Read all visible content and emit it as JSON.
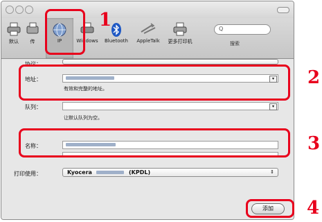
{
  "toolbar": {
    "items": [
      {
        "label": "默认",
        "icon": "printer-icon"
      },
      {
        "label": "传",
        "icon": "fax-icon"
      },
      {
        "label": "IP",
        "icon": "globe-icon"
      },
      {
        "label": "Windows",
        "icon": "windows-printer-icon"
      },
      {
        "label": "Bluetooth",
        "icon": "bluetooth-icon"
      },
      {
        "label": "AppleTalk",
        "icon": "appletalk-icon"
      },
      {
        "label": "更多打印机",
        "icon": "printer-icon"
      }
    ],
    "search_placeholder": "Q",
    "search_label": "搜索"
  },
  "form": {
    "protocol_label": "协议：",
    "address_label": "地址：",
    "address_hint": "有效和完整的地址。",
    "queue_label": "队列：",
    "queue_hint": "让默认队列为空。",
    "name_label": "名称：",
    "print_using_label": "打印使用：",
    "print_using_prefix": "Kyocera",
    "print_using_suffix": "(KPDL)"
  },
  "add_button_label": "添加",
  "callouts": [
    "1",
    "2",
    "3",
    "4"
  ],
  "colors": {
    "highlight": "#e8001c",
    "window_bg": "#e7e7e7"
  }
}
